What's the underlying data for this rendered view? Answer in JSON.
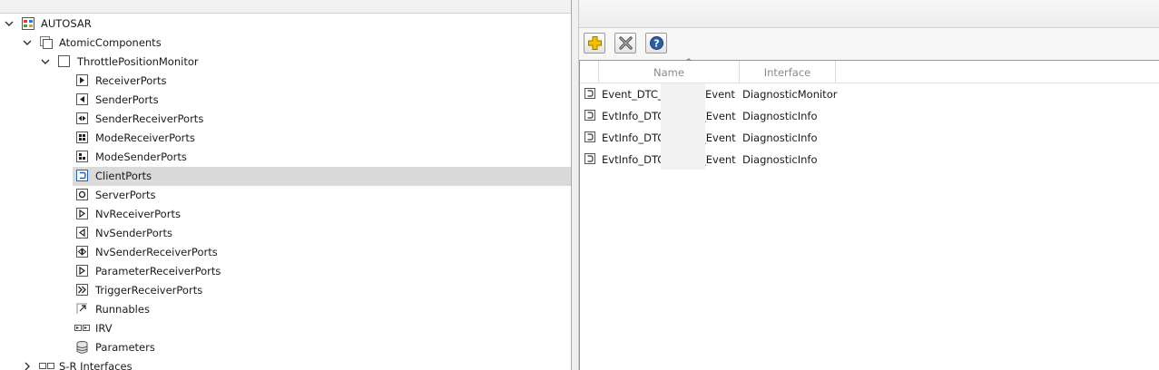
{
  "tree": {
    "root": {
      "label": "AUTOSAR",
      "icon": "autosar-package-icon",
      "expanded": true
    },
    "atomic_components": {
      "label": "AtomicComponents",
      "icon": "components-icon",
      "expanded": true
    },
    "component": {
      "label": "ThrottlePositionMonitor",
      "icon": "component-icon",
      "expanded": true
    },
    "items": [
      {
        "label": "ReceiverPorts",
        "icon": "receiver-port-icon"
      },
      {
        "label": "SenderPorts",
        "icon": "sender-port-icon"
      },
      {
        "label": "SenderReceiverPorts",
        "icon": "sender-receiver-port-icon"
      },
      {
        "label": "ModeReceiverPorts",
        "icon": "mode-receiver-port-icon"
      },
      {
        "label": "ModeSenderPorts",
        "icon": "mode-sender-port-icon"
      },
      {
        "label": "ClientPorts",
        "icon": "client-port-icon",
        "selected": true
      },
      {
        "label": "ServerPorts",
        "icon": "server-port-icon"
      },
      {
        "label": "NvReceiverPorts",
        "icon": "nv-receiver-port-icon"
      },
      {
        "label": "NvSenderPorts",
        "icon": "nv-sender-port-icon"
      },
      {
        "label": "NvSenderReceiverPorts",
        "icon": "nv-sender-receiver-port-icon"
      },
      {
        "label": "ParameterReceiverPorts",
        "icon": "parameter-receiver-port-icon"
      },
      {
        "label": "TriggerReceiverPorts",
        "icon": "trigger-receiver-port-icon"
      },
      {
        "label": "Runnables",
        "icon": "runnable-icon"
      },
      {
        "label": "IRV",
        "icon": "irv-icon"
      },
      {
        "label": "Parameters",
        "icon": "parameters-icon"
      }
    ],
    "next_sibling": {
      "label": "S-R Interfaces",
      "icon": "interfaces-icon",
      "expanded": false
    }
  },
  "toolbar": {
    "add_icon": "add-icon",
    "delete_icon": "delete-icon",
    "help_icon": "help-icon"
  },
  "table": {
    "columns": {
      "name": "Name",
      "interface": "Interface"
    },
    "sort_indicator": "^",
    "rows": [
      {
        "name": "Event_DTC_(",
        "name_suffix": "Event",
        "interface": "DiagnosticMonitor"
      },
      {
        "name": "EvtInfo_DTC",
        "name_suffix": "_Event",
        "interface": "DiagnosticInfo"
      },
      {
        "name": "EvtInfo_DTC",
        "name_suffix": "_Event",
        "interface": "DiagnosticInfo"
      },
      {
        "name": "EvtInfo_DTC",
        "name_suffix": "_Event",
        "interface": "DiagnosticInfo"
      }
    ]
  },
  "colors": {
    "selection": "#dadada",
    "icon_blue": "#1f5fbf",
    "add_yellow": "#f2c200"
  }
}
